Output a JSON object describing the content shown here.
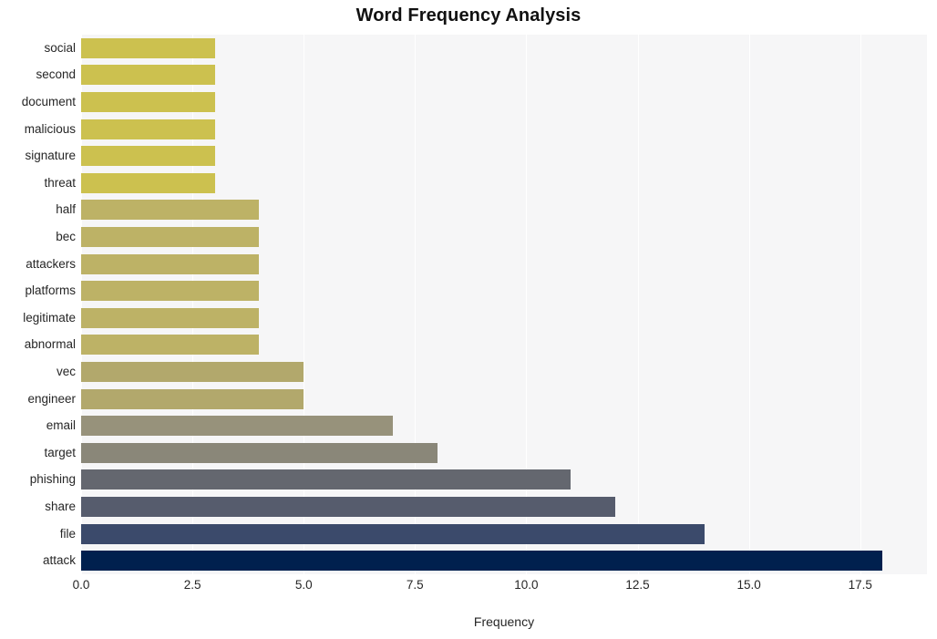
{
  "chart_data": {
    "type": "bar",
    "orientation": "horizontal",
    "title": "Word Frequency Analysis",
    "xlabel": "Frequency",
    "ylabel": "",
    "categories": [
      "attack",
      "file",
      "share",
      "phishing",
      "target",
      "email",
      "engineer",
      "vec",
      "abnormal",
      "legitimate",
      "platforms",
      "attackers",
      "bec",
      "half",
      "threat",
      "signature",
      "malicious",
      "document",
      "second",
      "social"
    ],
    "values": [
      18,
      14,
      12,
      11,
      8,
      7,
      5,
      5,
      4,
      4,
      4,
      4,
      4,
      4,
      3,
      3,
      3,
      3,
      3,
      3
    ],
    "xlim": [
      0,
      19.0
    ],
    "ylim": [
      -0.5,
      19.5
    ],
    "xticks": [
      0.0,
      2.5,
      5.0,
      7.5,
      10.0,
      12.5,
      15.0,
      17.5
    ],
    "xticklabels": [
      "0.0",
      "2.5",
      "5.0",
      "7.5",
      "10.0",
      "12.5",
      "15.0",
      "17.5"
    ],
    "grid": "vertical-only",
    "legend": "none",
    "colormap": "cividis",
    "bar_colors": [
      "#00204e",
      "#3b4a6b",
      "#565c6d",
      "#64676f",
      "#8a8779",
      "#97927b",
      "#b2a86c",
      "#b2a86c",
      "#bdb266",
      "#bdb266",
      "#bdb266",
      "#bdb266",
      "#bdb266",
      "#bdb266",
      "#ccc14f",
      "#ccc14f",
      "#ccc14f",
      "#ccc14f",
      "#ccc14f",
      "#ccc14f"
    ],
    "plot_background": "#f6f6f7",
    "gridline_color": "#ffffff",
    "figure_background": "#ffffff",
    "text_color": "#262626",
    "title_color": "#111111"
  }
}
